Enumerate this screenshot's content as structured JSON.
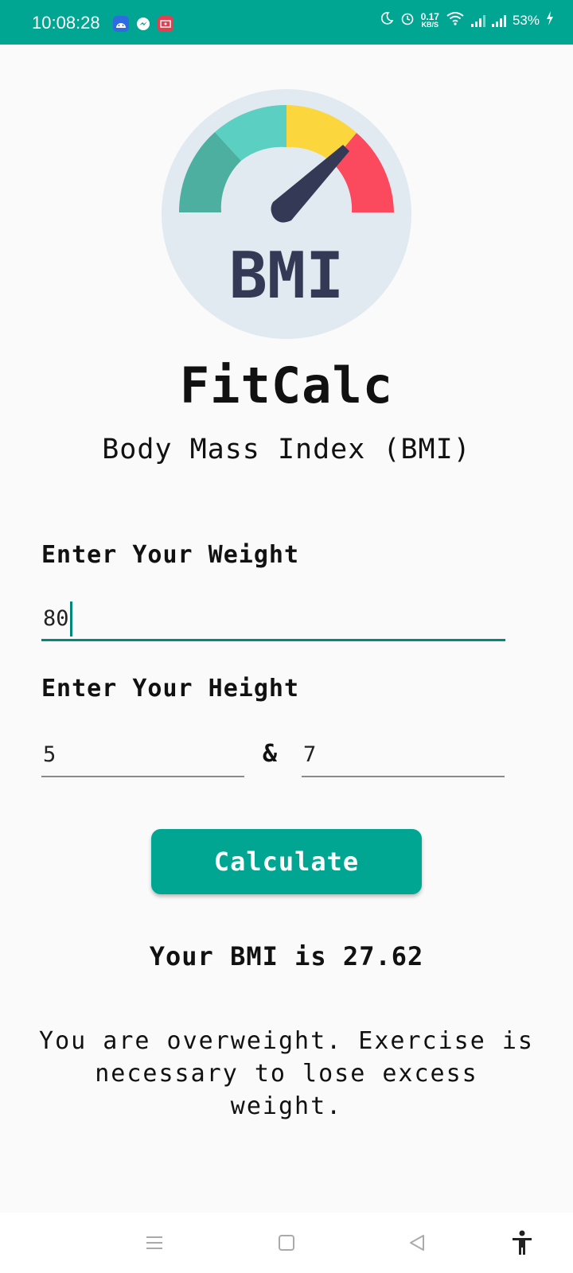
{
  "status_bar": {
    "time": "10:08:28",
    "net_speed_value": "0.17",
    "net_speed_unit": "KB/S",
    "battery": "53%",
    "notification_icons": [
      "android-icon",
      "messenger-icon",
      "screen-record-icon"
    ],
    "status_icons": [
      "moon-icon",
      "alarm-icon",
      "wifi-icon",
      "signal-icon",
      "signal-icon",
      "charging-icon"
    ]
  },
  "logo": {
    "text": "BMI",
    "colors": {
      "circle_bg": "#e1eaf0",
      "seg1": "#4caf9f",
      "seg2": "#5ccfc3",
      "seg3": "#fbd63d",
      "seg4": "#fb4a5d",
      "needle": "#343a55"
    }
  },
  "app": {
    "title": "FitCalc",
    "subtitle": "Body Mass Index (BMI)"
  },
  "form": {
    "weight_label": "Enter Your Weight",
    "weight_value": "80",
    "height_label": "Enter Your Height",
    "height_feet": "5",
    "height_separator": "&",
    "height_inches": "7",
    "calculate_label": "Calculate"
  },
  "result": {
    "bmi_text": "Your BMI is 27.62",
    "advice": "You are overweight. Exercise is necessary to lose excess weight."
  },
  "nav": {
    "icons": [
      "menu-icon",
      "home-icon",
      "back-icon",
      "accessibility-icon"
    ]
  },
  "colors": {
    "accent": "#00a692",
    "underline_active": "#00897b"
  }
}
